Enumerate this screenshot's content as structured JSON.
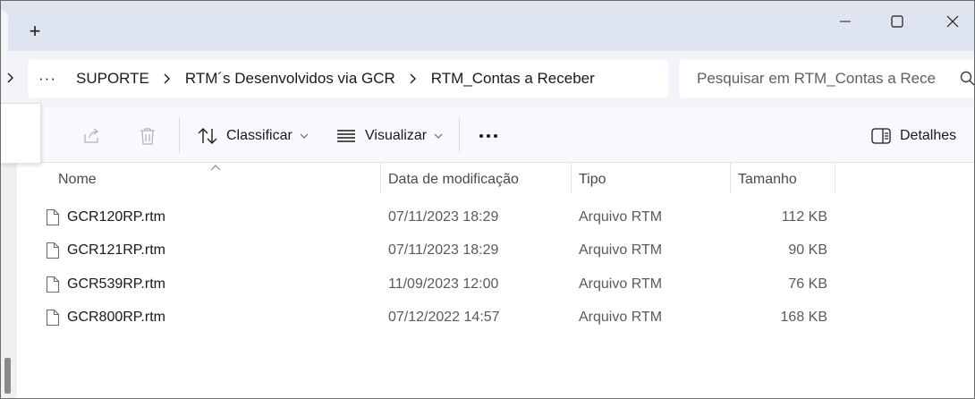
{
  "window": {
    "new_tab_label": "+"
  },
  "address": {
    "overflow_label": "···",
    "crumbs": [
      "SUPORTE",
      "RTM´s Desenvolvidos via GCR",
      "RTM_Contas a Receber"
    ]
  },
  "search": {
    "placeholder": "Pesquisar em RTM_Contas a Rece"
  },
  "toolbar": {
    "sort_label": "Classificar",
    "view_label": "Visualizar",
    "details_label": "Detalhes"
  },
  "columns": {
    "name": "Nome",
    "date": "Data de modificação",
    "type": "Tipo",
    "size": "Tamanho"
  },
  "files": [
    {
      "name": "GCR120RP.rtm",
      "date": "07/11/2023 18:29",
      "type": "Arquivo RTM",
      "size": "112 KB"
    },
    {
      "name": "GCR121RP.rtm",
      "date": "07/11/2023 18:29",
      "type": "Arquivo RTM",
      "size": "90 KB"
    },
    {
      "name": "GCR539RP.rtm",
      "date": "11/09/2023 12:00",
      "type": "Arquivo RTM",
      "size": "76 KB"
    },
    {
      "name": "GCR800RP.rtm",
      "date": "07/12/2022 14:57",
      "type": "Arquivo RTM",
      "size": "168 KB"
    }
  ],
  "icons": {
    "file": "file-icon",
    "share": "share-icon",
    "delete": "trash-icon",
    "sort": "sort-icon",
    "view": "view-icon",
    "more": "more-icon",
    "details": "details-pane-icon",
    "search": "search-icon"
  },
  "colors": {
    "titlebar": "#dfe4f1",
    "addressbar": "#f3f4f9",
    "toolbar": "#f8f9fc"
  }
}
